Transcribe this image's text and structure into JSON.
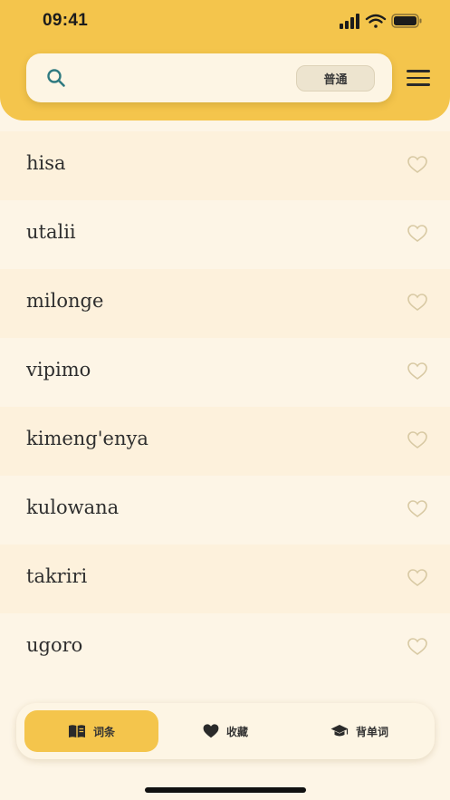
{
  "status_bar": {
    "time": "09:41"
  },
  "search": {
    "placeholder": "",
    "mode_label": "普通"
  },
  "words": [
    {
      "text": "hisa"
    },
    {
      "text": "utalii"
    },
    {
      "text": "milonge"
    },
    {
      "text": "vipimo"
    },
    {
      "text": "kimeng'enya"
    },
    {
      "text": "kulowana"
    },
    {
      "text": "takriri"
    },
    {
      "text": "ugoro"
    }
  ],
  "tabs": [
    {
      "label": "词条",
      "icon": "book-icon",
      "active": true
    },
    {
      "label": "收藏",
      "icon": "heart-icon",
      "active": false
    },
    {
      "label": "背单词",
      "icon": "graduation-cap-icon",
      "active": false
    }
  ],
  "colors": {
    "accent": "#f4c54c",
    "background": "#fdf5e6",
    "row_alt": "#fdf1dc",
    "search_icon": "#2f7a80",
    "heart_outline": "#d8c9a3"
  }
}
